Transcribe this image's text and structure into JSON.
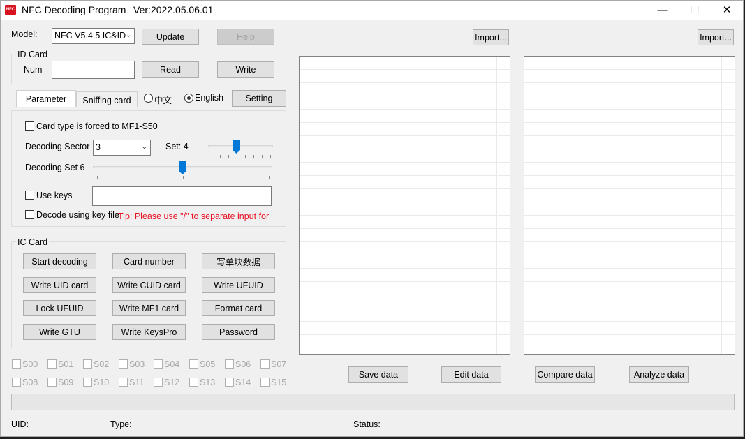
{
  "window": {
    "icon_text": "NFC",
    "title": "NFC  Decoding Program",
    "version": "Ver:2022.05.06.01",
    "controls": [
      "—",
      "☐",
      "✕"
    ]
  },
  "toolbar": {
    "model_label": "Model:",
    "model_value": "NFC V5.4.5 IC&ID",
    "update_label": "Update",
    "help_label": "Help",
    "import_left_label": "Import...",
    "import_right_label": "Import..."
  },
  "id_card": {
    "group_label": "ID Card",
    "num_label": "Num",
    "num_value": "",
    "read_label": "Read",
    "write_label": "Write"
  },
  "tabs": {
    "items": [
      "Parameter",
      "Sniffing card"
    ],
    "lang_zh": "中文",
    "lang_en": "English",
    "selected_language": "English",
    "setting_label": "Setting"
  },
  "parameter": {
    "force_mf1_label": "Card type is forced to MF1-S50",
    "force_mf1_checked": false,
    "decoding_sector_label": "Decoding Sector",
    "decoding_sector_value": "3",
    "set_label": "Set: 4",
    "set_level": 4,
    "decoding_set_label": "Decoding Set 6",
    "decoding_set_level": 6,
    "use_keys_label": "Use keys",
    "use_keys_checked": false,
    "keys_value": "",
    "key_file_label": "Decode using key file",
    "key_file_checked": false,
    "tip": "Tip: Please use \"/\" to separate input for"
  },
  "ic_card": {
    "group_label": "IC Card",
    "buttons": [
      [
        "Start decoding",
        "Card number",
        "写单块数据"
      ],
      [
        "Write UID card",
        "Write CUID card",
        "Write UFUID"
      ],
      [
        "Lock UFUID",
        "Write MF1 card",
        "Format card"
      ],
      [
        "Write GTU",
        "Write KeysPro",
        "Password"
      ]
    ]
  },
  "sectors": {
    "row1": [
      "S00",
      "S01",
      "S02",
      "S03",
      "S04",
      "S05",
      "S06",
      "S07"
    ],
    "row2": [
      "S08",
      "S09",
      "S10",
      "S11",
      "S12",
      "S13",
      "S14",
      "S15"
    ]
  },
  "actions": {
    "save_label": "Save data",
    "edit_label": "Edit data",
    "compare_label": "Compare data",
    "analyze_label": "Analyze data"
  },
  "status": {
    "uid_label": "UID:",
    "type_label": "Type:",
    "status_label": "Status:"
  },
  "colors": {
    "accent": "#0078d7",
    "tip_red": "#e81123",
    "window_bg": "#f0f0f0"
  }
}
